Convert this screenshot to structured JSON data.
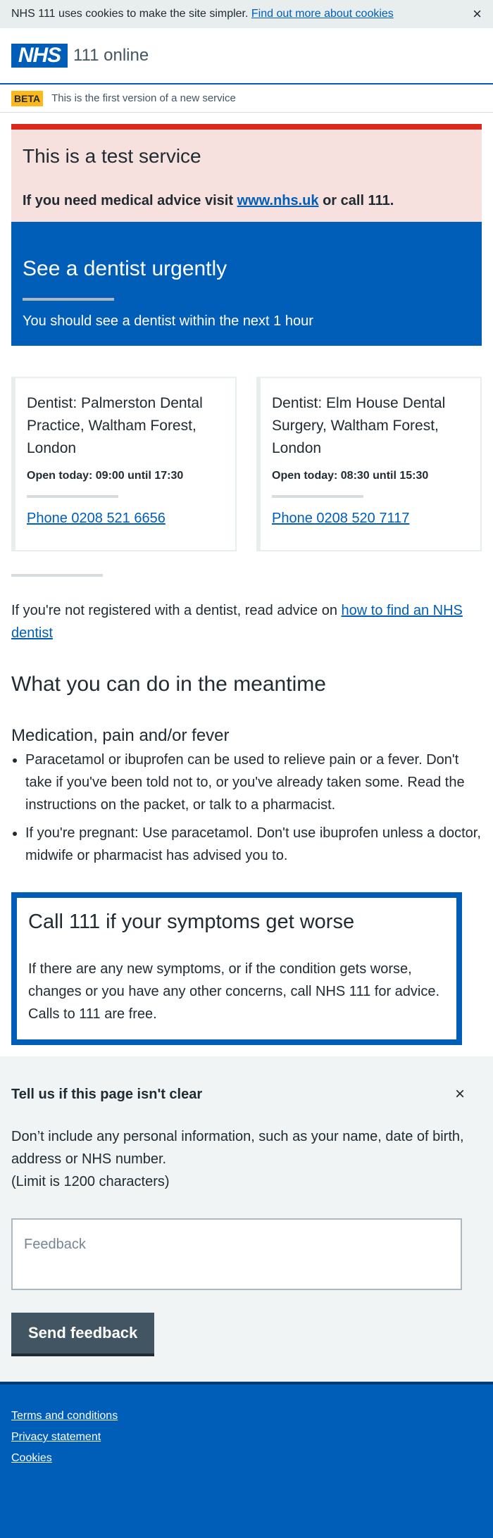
{
  "cookie_banner": {
    "text": "NHS 111 uses cookies to make the site simpler.",
    "link": "Find out more about cookies",
    "close": "×"
  },
  "header": {
    "logo": "NHS",
    "service": "111 online"
  },
  "beta": {
    "tag": "BETA",
    "text": "This is the first version of a new service"
  },
  "test_banner": {
    "title": "This is a test service",
    "prefix": "If you need medical advice visit",
    "link": "www.nhs.uk",
    "suffix": "or call 111."
  },
  "care": {
    "title": "See a dentist urgently",
    "subtitle": "You should see a dentist within the next 1 hour"
  },
  "services": [
    {
      "name": "Dentist: Palmerston Dental Practice, Waltham Forest, London",
      "hours": "Open today: 09:00 until 17:30",
      "phone": "Phone 0208 521 6656"
    },
    {
      "name": "Dentist: Elm House Dental Surgery, Waltham Forest, London",
      "hours": "Open today: 08:30 until 15:30",
      "phone": "Phone 0208 520 7117"
    }
  ],
  "registration": {
    "text": "If you're not registered with a dentist, read advice on",
    "link": "how to find an NHS dentist"
  },
  "meantime": {
    "heading": "What you can do in the meantime",
    "subheading": "Medication, pain and/or fever",
    "items": [
      "Paracetamol or ibuprofen can be used to relieve pain or a fever. Don't take if you've been told not to, or you've already taken some. Read the instructions on the packet, or talk to a pharmacist.",
      "If you're pregnant: Use paracetamol. Don't use ibuprofen unless a doctor, midwife or pharmacist has advised you to."
    ]
  },
  "callbox": {
    "title": "Call 111 if your symptoms get worse",
    "text": "If there are any new symptoms, or if the condition gets worse, changes or you have any other concerns, call NHS 111 for advice. Calls to 111 are free."
  },
  "feedback": {
    "heading": "Tell us if this page isn't clear",
    "close": "×",
    "info": "Don’t include any personal information, such as your name, date of birth, address or NHS number.",
    "limit": "(Limit is 1200 characters)",
    "placeholder": "Feedback",
    "button": "Send feedback"
  },
  "footer": {
    "links": [
      "Terms and conditions",
      "Privacy statement",
      "Cookies"
    ]
  },
  "colors": {
    "nhs_blue": "#005eb8",
    "warning_red": "#da291c",
    "beta_yellow": "#ffb81c"
  }
}
